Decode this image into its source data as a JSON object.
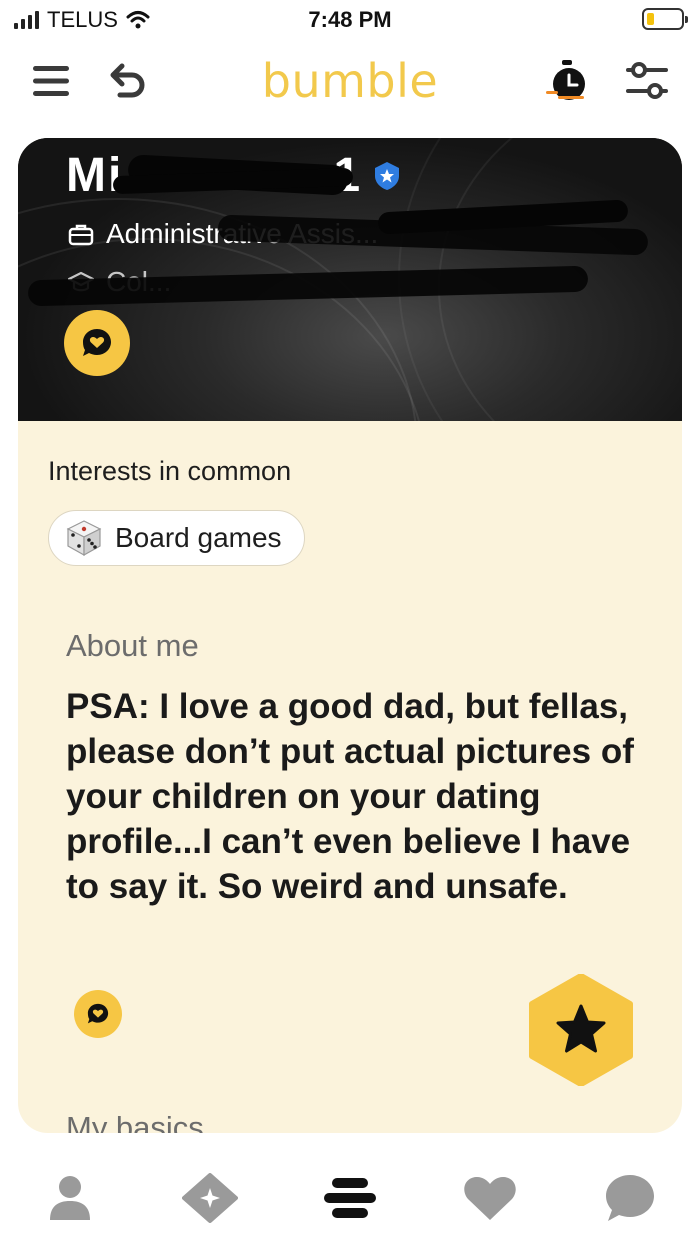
{
  "status_bar": {
    "carrier": "TELUS",
    "time": "7:48 PM",
    "battery_level_percent": 20,
    "battery_color": "#f4c20d"
  },
  "header": {
    "logo_text": "bumble",
    "logo_color": "#f2c94c",
    "icons": [
      "menu-icon",
      "undo-icon",
      "timer-icon",
      "filters-icon"
    ]
  },
  "profile": {
    "name_visible": "Mi",
    "age_visible": "1",
    "verified": true,
    "job": "Administrative Assis...",
    "education": "Col..."
  },
  "interests": {
    "title": "Interests in common",
    "chips": [
      {
        "icon": "dice-icon",
        "label": "Board games"
      }
    ]
  },
  "about": {
    "title": "About me",
    "text": "PSA: I love a good dad, but fellas, please don’t put actual pictures of your children on your dating profile...I can’t even believe I have to say it. So weird and unsafe."
  },
  "basics": {
    "title": "My basics"
  },
  "bottom_nav": {
    "items": [
      "profile-icon",
      "premium-icon",
      "people-icon",
      "likes-icon",
      "chats-icon"
    ],
    "active": "people-icon"
  },
  "colors": {
    "accent": "#f6c644",
    "card_background": "#fbf3dc",
    "nav_icon": "#9a9a9a"
  }
}
